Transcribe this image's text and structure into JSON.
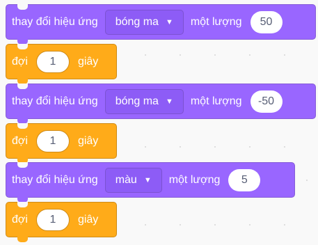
{
  "blocks": [
    {
      "category": "looks",
      "kind": "change-effect",
      "prefix": "thay đổi hiệu ứng",
      "effect": "bóng ma",
      "suffix": "một lượng",
      "value": "50"
    },
    {
      "category": "control",
      "kind": "wait",
      "prefix": "đợi",
      "value": "1",
      "suffix": "giây"
    },
    {
      "category": "looks",
      "kind": "change-effect",
      "prefix": "thay đổi hiệu ứng",
      "effect": "bóng ma",
      "suffix": "một lượng",
      "value": "-50"
    },
    {
      "category": "control",
      "kind": "wait",
      "prefix": "đợi",
      "value": "1",
      "suffix": "giây"
    },
    {
      "category": "looks",
      "kind": "change-effect",
      "prefix": "thay đổi hiệu ứng",
      "effect": "màu",
      "suffix": "một lượng",
      "value": "5"
    },
    {
      "category": "control",
      "kind": "wait",
      "prefix": "đợi",
      "value": "1",
      "suffix": "giây"
    }
  ],
  "icons": {
    "dropdown_caret": "caret-down-icon"
  },
  "colors": {
    "looks": "#9966ff",
    "control": "#ffab19",
    "background": "#f9f9f9",
    "input_text": "#575e75"
  }
}
